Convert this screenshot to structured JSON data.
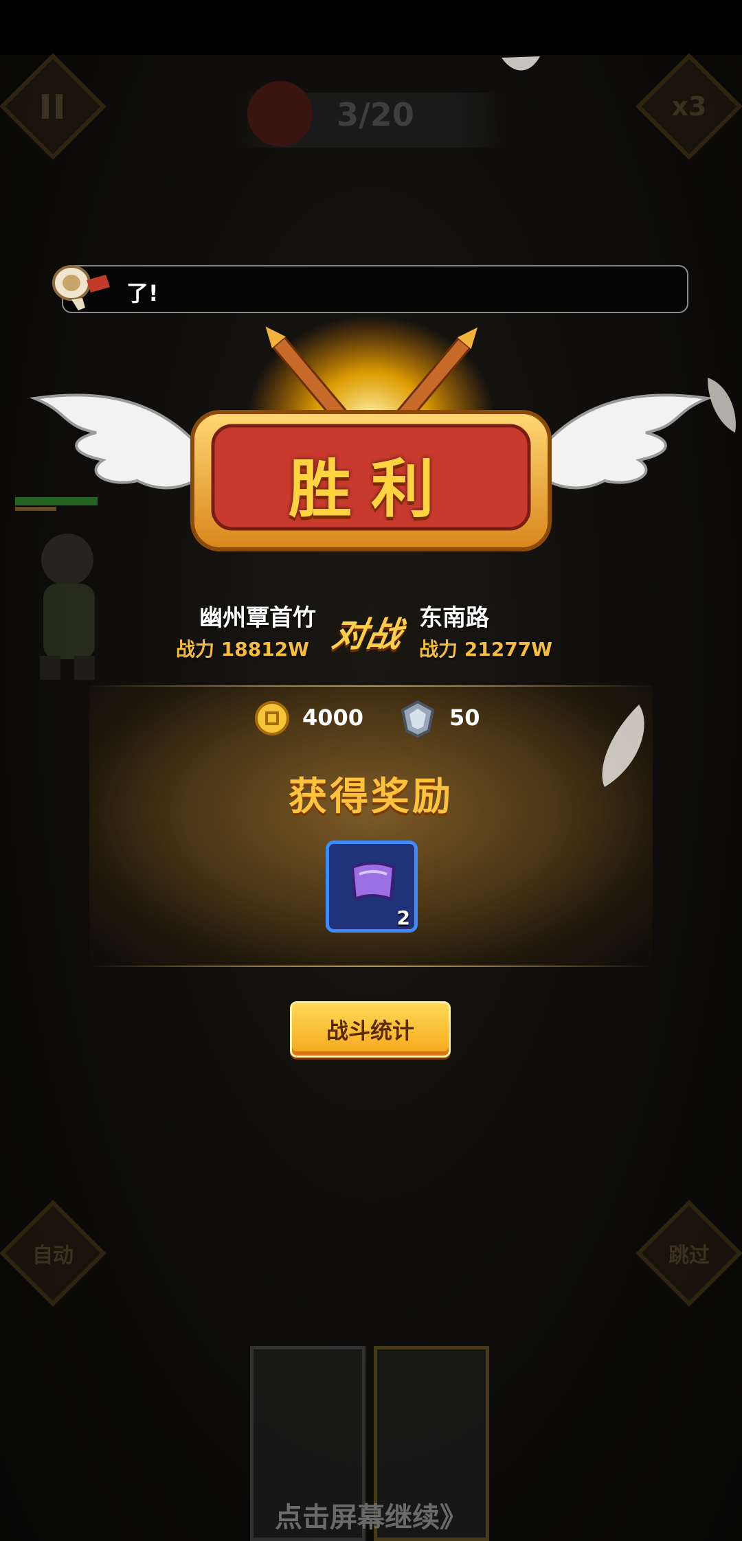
{
  "hud": {
    "pause_icon": "pause-icon",
    "wave": "3/20",
    "speed": "x3",
    "auto_label": "自动",
    "skip_label": "跳过"
  },
  "notice": {
    "text": "了!"
  },
  "banner": {
    "title": "胜利"
  },
  "battle": {
    "left_name": "幽州覃首竹",
    "left_power": "战力  18812W",
    "vs": "对战",
    "right_name": "东南路",
    "right_power": "战力  21277W"
  },
  "rewards": {
    "coins": "4000",
    "gems": "50",
    "title": "获得奖励",
    "item_count": "2"
  },
  "stats_button": "战斗统计",
  "continue_text": "点击屏幕继续》",
  "colors": {
    "accent_gold": "#ffc23c",
    "item_border": "#3d8bff",
    "panel": "#7b5a27"
  }
}
